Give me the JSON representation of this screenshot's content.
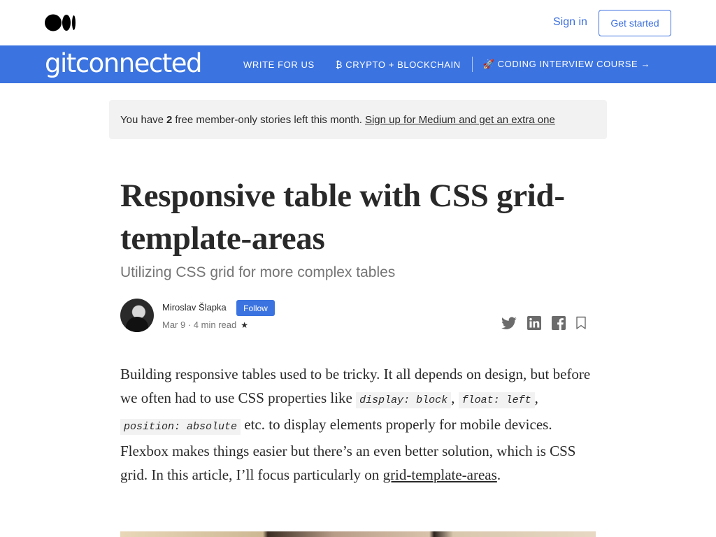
{
  "header": {
    "sign_in": "Sign in",
    "get_started": "Get started"
  },
  "publication": {
    "name": "gitconnected",
    "nav": [
      {
        "label": "WRITE FOR US"
      },
      {
        "label": "₿ CRYPTO + BLOCKCHAIN"
      },
      {
        "label": "🚀 CODING INTERVIEW COURSE →"
      }
    ]
  },
  "banner": {
    "prefix": "You have",
    "count": "2",
    "suffix": "free member-only stories left this month.",
    "link": "Sign up for Medium and get an extra one"
  },
  "article": {
    "title": "Responsive table with CSS grid-template-areas",
    "subtitle": "Utilizing CSS grid for more complex tables",
    "author": "Miroslav Šlapka",
    "follow": "Follow",
    "date": "Mar 9",
    "read_time": "4 min read",
    "star": "★",
    "body": {
      "t1": "Building responsive tables used to be tricky. It all depends on design, but before we often had to use CSS properties like",
      "c1": "display: block",
      "t2": ",",
      "c2": "float: left",
      "t3": ",",
      "c3": "position: absolute",
      "t4": "etc. to display elements properly for mobile devices. Flexbox makes things easier but there’s an even better solution, which is CSS grid. In this article, I’ll focus particularly on",
      "link": "grid-template-areas",
      "t5": "."
    }
  },
  "icons": {
    "share": [
      "twitter-icon",
      "linkedin-icon",
      "facebook-icon",
      "bookmark-icon"
    ]
  }
}
